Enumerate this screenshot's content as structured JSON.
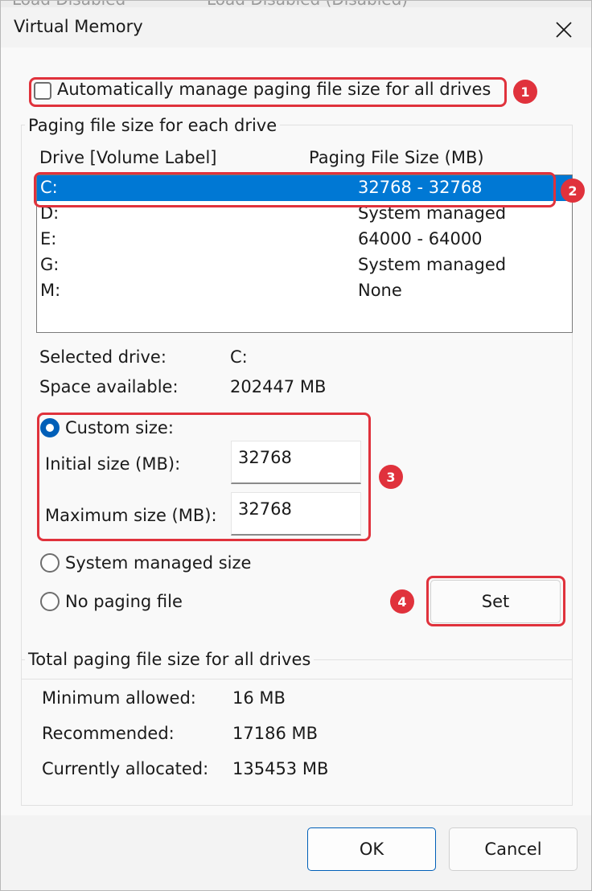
{
  "window": {
    "title": "Virtual Memory",
    "top_strip_text": [
      "Load Disabled",
      "Load Disabled (Disabled)"
    ]
  },
  "auto_manage": {
    "label": "Automatically manage paging file size for all drives",
    "checked": false
  },
  "per_drive": {
    "group_label": "Paging file size for each drive",
    "col_drive": "Drive  [Volume Label]",
    "col_size": "Paging File Size (MB)",
    "rows": [
      {
        "drive": "C:",
        "size": "32768 - 32768",
        "selected": true
      },
      {
        "drive": "D:",
        "size": "System managed",
        "selected": false
      },
      {
        "drive": "E:",
        "size": "64000 - 64000",
        "selected": false
      },
      {
        "drive": "G:",
        "size": "System managed",
        "selected": false
      },
      {
        "drive": "M:",
        "size": "None",
        "selected": false
      }
    ],
    "selected_drive_label": "Selected drive:",
    "selected_drive_value": "C:",
    "space_available_label": "Space available:",
    "space_available_value": "202447 MB",
    "custom_size_label": "Custom size:",
    "initial_size_label": "Initial size (MB):",
    "initial_size_value": "32768",
    "maximum_size_label": "Maximum size (MB):",
    "maximum_size_value": "32768",
    "system_managed_label": "System managed size",
    "no_paging_label": "No paging file",
    "set_label": "Set",
    "selected_option": "custom"
  },
  "totals": {
    "group_label": "Total paging file size for all drives",
    "minimum_label": "Minimum allowed:",
    "minimum_value": "16 MB",
    "recommended_label": "Recommended:",
    "recommended_value": "17186 MB",
    "allocated_label": "Currently allocated:",
    "allocated_value": "135453 MB"
  },
  "footer": {
    "ok_label": "OK",
    "cancel_label": "Cancel"
  },
  "annotations": {
    "badges": [
      "1",
      "2",
      "3",
      "4"
    ],
    "color": "#e0323c"
  },
  "colors": {
    "accent": "#0078d4",
    "radio_accent": "#005fb8"
  },
  "icons": {
    "close": "close-icon",
    "checkbox": "checkbox-icon",
    "radio": "radio-icon"
  }
}
